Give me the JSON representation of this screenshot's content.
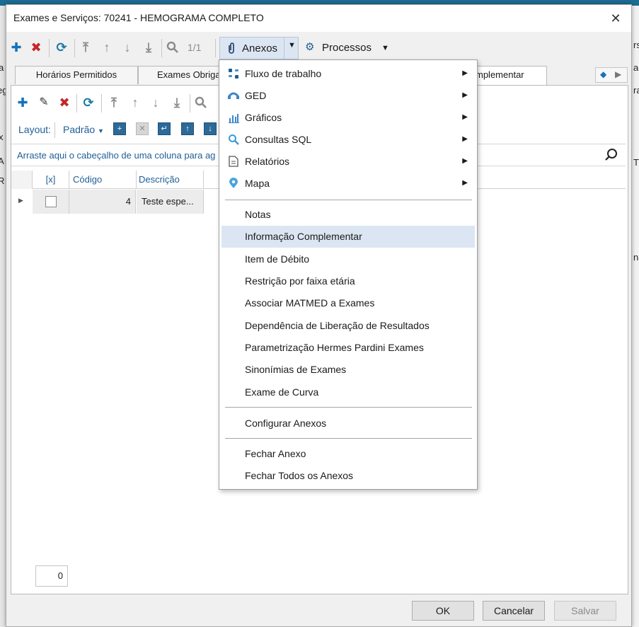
{
  "dialog": {
    "title": "Exames e Serviços: 70241 - HEMOGRAMA COMPLETO",
    "close_symbol": "✕"
  },
  "toolbar": {
    "page_indicator": "1/1",
    "anexos_label": "Anexos",
    "processos_label": "Processos",
    "icons": [
      "plus-icon",
      "delete-icon",
      "refresh-icon",
      "first-icon",
      "up-icon",
      "down-icon",
      "last-icon",
      "search-icon"
    ]
  },
  "tabs": [
    {
      "label": "Horários Permitidos"
    },
    {
      "label": "Exames Obriga"
    },
    {
      "label": "mplementar"
    }
  ],
  "panel": {
    "layout_label": "Layout:",
    "layout_value": "Padrão",
    "group_hint": "Arraste aqui o cabeçalho de uma coluna para ag",
    "columns": [
      "[x]",
      "Código",
      "Descrição"
    ],
    "rows": [
      {
        "code": "4",
        "description": "Teste espe..."
      }
    ],
    "footer_count": "0"
  },
  "buttons": {
    "ok": "OK",
    "cancel": "Cancelar",
    "save": "Salvar"
  },
  "menu": {
    "items": [
      {
        "label": "Fluxo de trabalho",
        "icon": "workflow-icon",
        "submenu": true
      },
      {
        "label": "GED",
        "icon": "ged-icon",
        "submenu": true
      },
      {
        "label": "Gráficos",
        "icon": "chart-icon",
        "submenu": true
      },
      {
        "label": "Consultas SQL",
        "icon": "search-icon",
        "submenu": true
      },
      {
        "label": "Relatórios",
        "icon": "document-icon",
        "submenu": true
      },
      {
        "label": "Mapa",
        "icon": "map-pin-icon",
        "submenu": true
      },
      {
        "label": "Notas"
      },
      {
        "label": "Informação Complementar",
        "highlighted": true
      },
      {
        "label": "Item de Débito"
      },
      {
        "label": "Restrição por faixa etária"
      },
      {
        "label": "Associar MATMED a Exames"
      },
      {
        "label": "Dependência de Liberação de Resultados"
      },
      {
        "label": "Parametrização Hermes Pardini Exames"
      },
      {
        "label": "Sinonímias de Exames"
      },
      {
        "label": "Exame de Curva"
      },
      {
        "label": "Configurar Anexos"
      },
      {
        "label": "Fechar Anexo"
      },
      {
        "label": "Fechar Todos os Anexos"
      }
    ]
  },
  "background": {
    "left_fragments": [
      "a",
      "eg",
      "x",
      "A",
      "R"
    ],
    "right_fragments": [
      "rs",
      "ac",
      "ra",
      "T",
      "na"
    ]
  },
  "colors": {
    "accent": "#1673b7",
    "danger": "#c3272b",
    "menu_highlight": "#dce6f3",
    "app_header": "#1c6d92"
  }
}
